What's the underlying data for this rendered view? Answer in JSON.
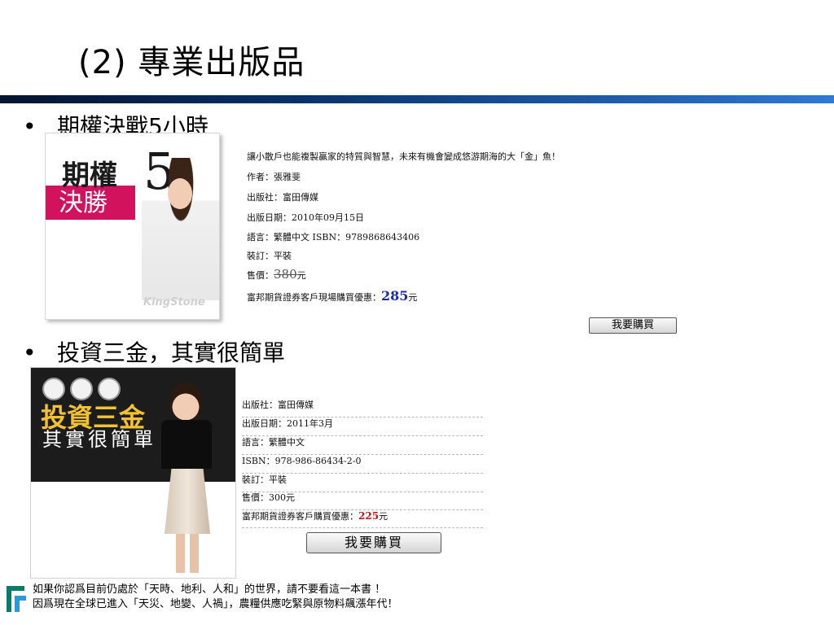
{
  "slide": {
    "title": "(2) 專業出版品"
  },
  "bullets": {
    "marker": "•",
    "item1": "期權決戰5小時",
    "item2": "投資三金，其實很簡單"
  },
  "book1": {
    "cover": {
      "title_a": "期權",
      "title_num": "5",
      "title_b": "決勝",
      "brand": "KingStone"
    },
    "lines": {
      "tagline": "讓小散戶也能複製贏家的特質與智慧，未來有機會變成悠游期海的大「金」魚！",
      "author": "作者：張雅斐",
      "publisher": "出版社：富田傳媒",
      "date": "出版日期：2010年09月15日",
      "lang_isbn": "語言：繁體中文 ISBN：9789868643406",
      "binding": "裝訂：平裝",
      "price_label": "售價：",
      "price": "380",
      "price_unit": "元",
      "discount_label": "富邦期貨證券客戶現場購買優惠：",
      "discount_price": "285",
      "discount_unit": "元"
    },
    "buy_button": "我要購買"
  },
  "book2": {
    "cover": {
      "title_a": "投資三金",
      "title_b": "其實很簡單"
    },
    "rows": {
      "publisher": "出版社：富田傳媒",
      "date": "出版日期：2011年3月",
      "lang": "語言：繁體中文",
      "isbn": "ISBN：978-986-86434-2-0",
      "binding": "裝訂：平裝",
      "price": "售價：300元",
      "discount_label": "富邦期貨證券客戶購買優惠：",
      "discount_price": "225",
      "discount_unit": "元"
    },
    "buy_button": "我要購買"
  },
  "footer": {
    "note1": "如果你認爲目前仍處於「天時、地利、人和」的世界，請不要看這一本書 ！",
    "note2": "因爲現在全球已進入「天災、地變、人禍」，農糧供應吃緊與原物料飆漲年代！"
  },
  "colors": {
    "title_bar_dark": "#04142e",
    "title_bar_light": "#2e7ad6",
    "discount_blue": "#1a2ca5",
    "discount_red": "#c8101a",
    "logo_green": "#0a7a6a"
  }
}
